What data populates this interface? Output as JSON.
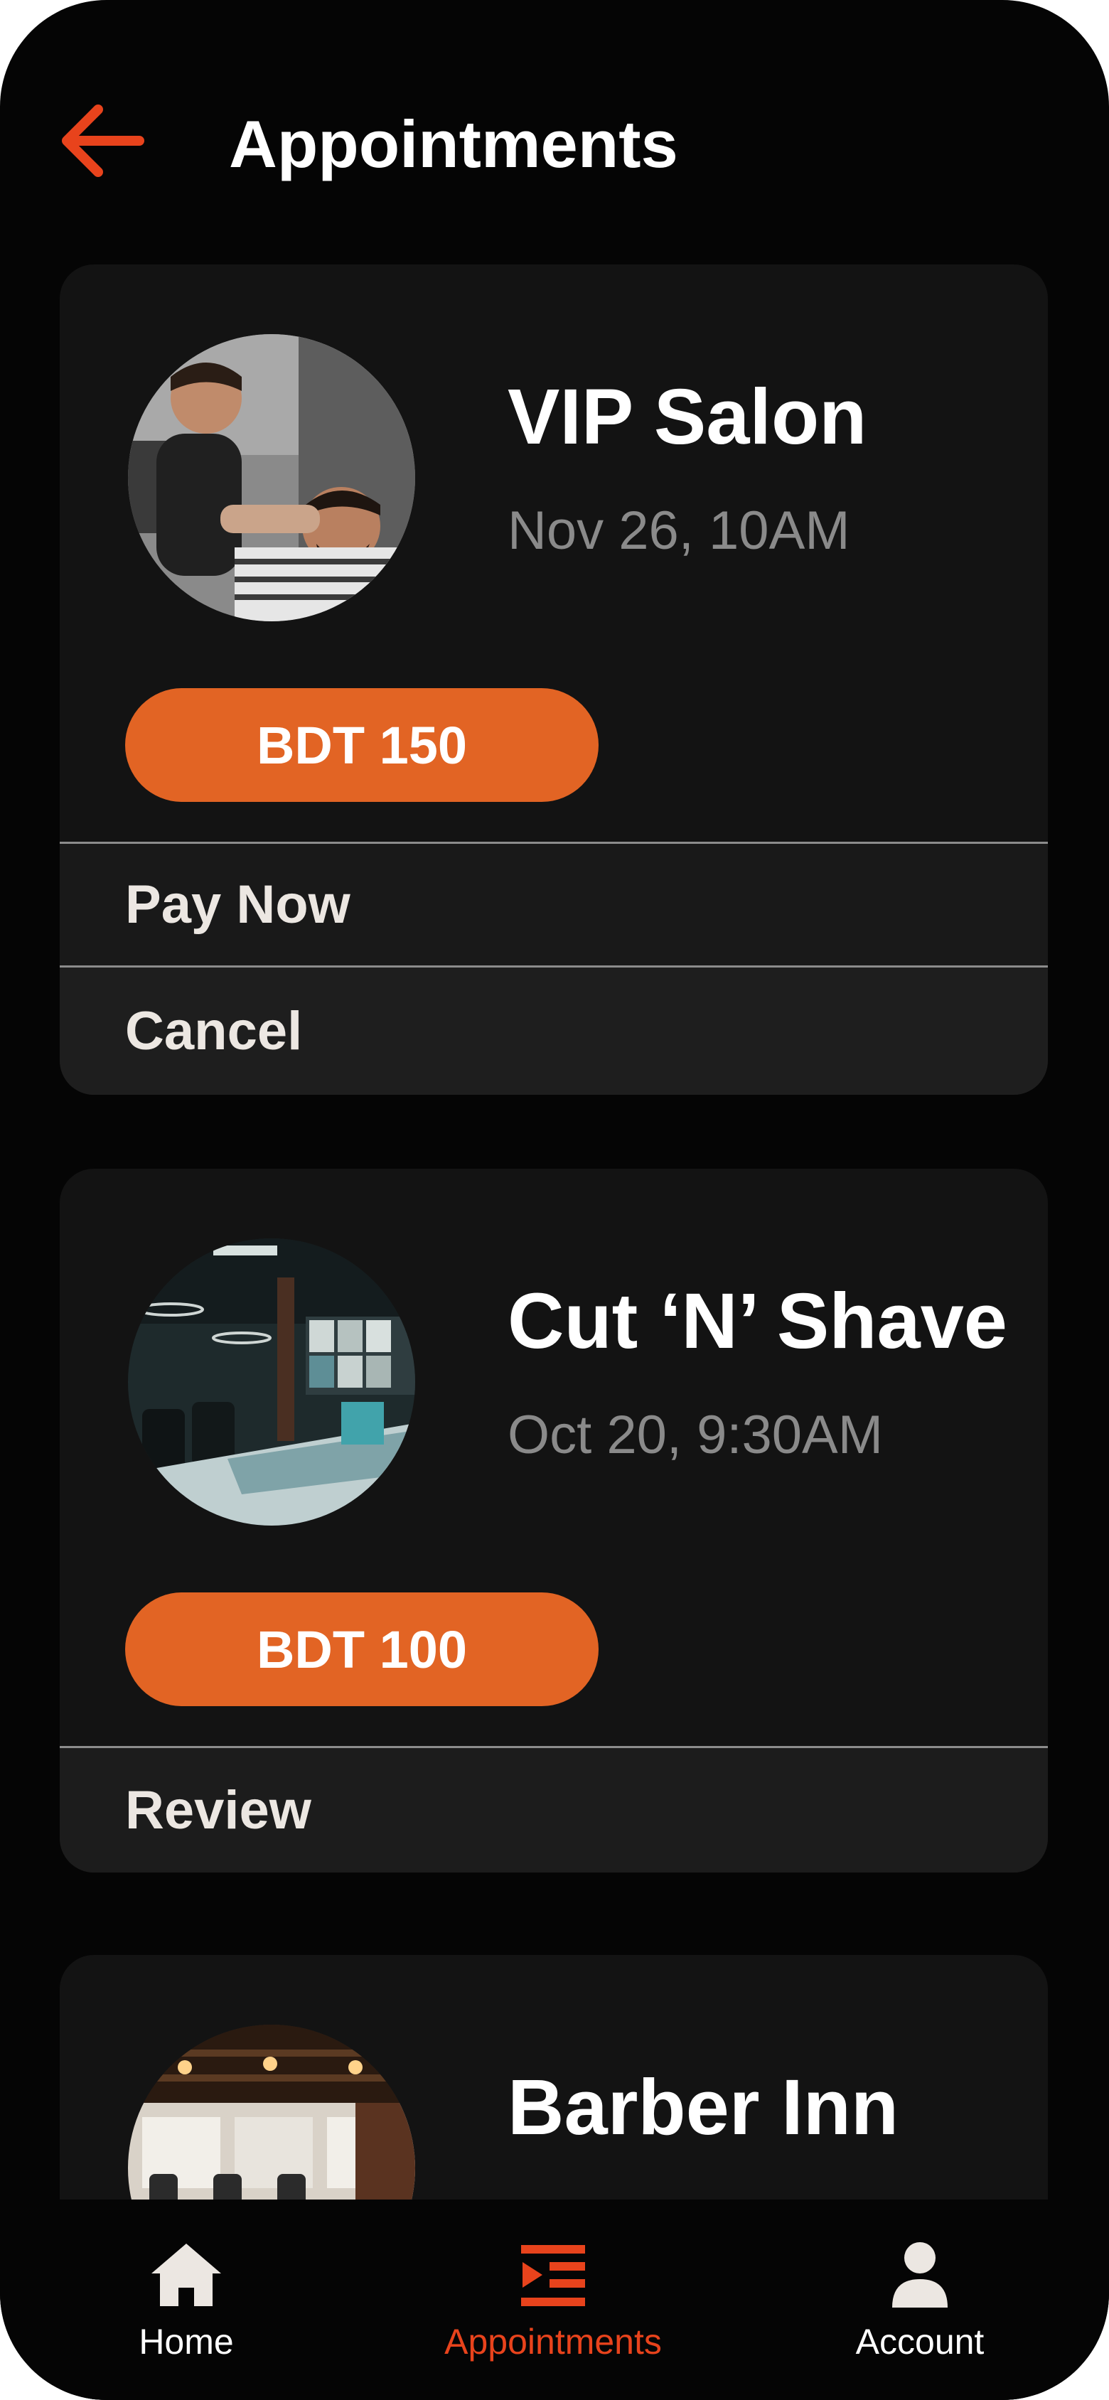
{
  "header": {
    "title": "Appointments",
    "back_icon": "arrow-left-icon",
    "accent_color": "#e8431c"
  },
  "appointments": [
    {
      "name": "VIP Salon",
      "date": "Nov 26, 10AM",
      "price": "BDT 150",
      "image": "barber-shaving-photo",
      "actions": [
        "Pay Now",
        "Cancel"
      ]
    },
    {
      "name": "Cut ‘N’ Shave",
      "date": "Oct 20, 9:30AM",
      "price": "BDT 100",
      "image": "salon-interior-photo",
      "actions": [
        "Review"
      ]
    },
    {
      "name": "Barber Inn",
      "image": "barbershop-interior-photo"
    }
  ],
  "bottom_nav": {
    "items": [
      {
        "label": "Home",
        "icon": "home-icon",
        "active": false
      },
      {
        "label": "Appointments",
        "icon": "appointments-list-icon",
        "active": true
      },
      {
        "label": "Account",
        "icon": "user-icon",
        "active": false
      }
    ]
  },
  "colors": {
    "background": "#050505",
    "card": "#131313",
    "price_pill": "#e26424",
    "active_nav": "#e8431c"
  }
}
